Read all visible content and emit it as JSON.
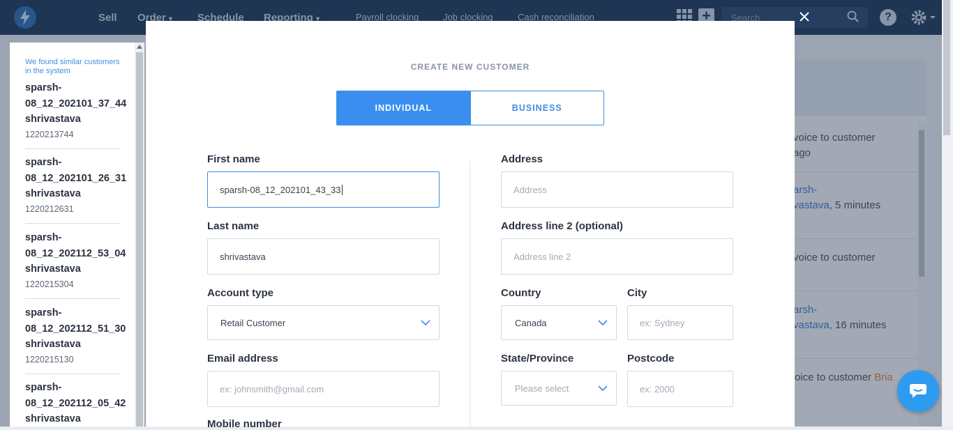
{
  "nav": {
    "items": [
      "Sell",
      "Order",
      "Schedule",
      "Reporting"
    ],
    "subitems": [
      "Payroll clocking",
      "Job clocking",
      "Cash reconciliation"
    ],
    "search_placeholder": "Search"
  },
  "background": {
    "rows": [
      {
        "a": "voice to customer",
        "b": "ago"
      },
      {
        "a": "arsh-",
        "b": "vastava",
        "c": ", 5 minutes"
      },
      {
        "a": "voice to customer"
      },
      {
        "a": "arsh-",
        "b": "vastava,",
        "c": "16 minutes"
      },
      {
        "a": "oice to customer ",
        "b": "Bria"
      }
    ]
  },
  "suggestions": {
    "note": "We found similar customers in the system",
    "items": [
      {
        "line1": "sparsh-",
        "line2": "08_12_202101_37_44",
        "line3": "shrivastava",
        "code": "1220213744"
      },
      {
        "line1": "sparsh-",
        "line2": "08_12_202101_26_31",
        "line3": "shrivastava",
        "code": "1220212631"
      },
      {
        "line1": "sparsh-",
        "line2": "08_12_202112_53_04",
        "line3": "shrivastava",
        "code": "1220215304"
      },
      {
        "line1": "sparsh-",
        "line2": "08_12_202112_51_30",
        "line3": "shrivastava",
        "code": "1220215130"
      },
      {
        "line1": "sparsh-",
        "line2": "08_12_202112_05_42",
        "line3": "shrivastava",
        "code": ""
      }
    ]
  },
  "modal": {
    "title": "CREATE NEW CUSTOMER",
    "tabs": {
      "individual": "INDIVIDUAL",
      "business": "BUSINESS"
    },
    "first_name": {
      "label": "First name",
      "value": "sparsh-08_12_202101_43_33"
    },
    "last_name": {
      "label": "Last name",
      "value": "shrivastava"
    },
    "account_type": {
      "label": "Account type",
      "value": "Retail Customer"
    },
    "email": {
      "label": "Email address",
      "placeholder": "ex: johnsmith@gmail.com"
    },
    "mobile": {
      "label": "Mobile number"
    },
    "address": {
      "label": "Address",
      "placeholder": "Address"
    },
    "address2": {
      "label": "Address line 2 (optional)",
      "placeholder": "Address line 2"
    },
    "country": {
      "label": "Country",
      "value": "Canada"
    },
    "city": {
      "label": "City",
      "placeholder": "ex: Sydney"
    },
    "state": {
      "label": "State/Province",
      "placeholder": "Please select"
    },
    "postcode": {
      "label": "Postcode",
      "placeholder": "ex: 2000"
    }
  },
  "colors": {
    "primary": "#3a8ef0",
    "nav_bg": "#1f3a5c",
    "chat": "#2d9bf0"
  },
  "icons": [
    "logo-icon",
    "apps-grid-icon",
    "plus-icon",
    "search-icon",
    "close-icon",
    "help-icon",
    "gear-icon",
    "chevron-down-icon",
    "chat-icon"
  ]
}
